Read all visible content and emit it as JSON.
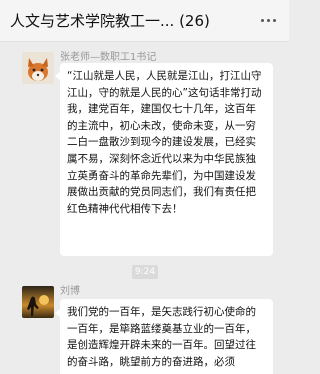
{
  "window": {
    "title": "人文与艺术学院教工一... (26)",
    "more_icon": "more-dots-icon"
  },
  "messages": [
    {
      "sender": "张老师—数职工1书记",
      "avatar": "fox-avatar",
      "text": "“江山就是人民，人民就是江山，打江山守江山，守的就是人民的心”这句话非常打动我，建党百年，建国仅七十几年，这百年的主流中，初心未改，使命未变，从一穷二白一盘散沙到现今的建设发展，已经实属不易，深刻怀念近代以来为中华民族独立英勇奋斗的革命先辈们，为中国建设发展做出贡献的党员同志们，我们有责任把红色精神代代相传下去！"
    },
    {
      "time": "9:24"
    },
    {
      "sender": "刘博",
      "avatar": "silhouette-avatar",
      "text": "我们党的一百年，是矢志践行初心使命的一百年，是筚路蓝缕奠基立业的一百年，是创造辉煌开辟未来的一百年。回望过往的奋斗路，眺望前方的奋进路，必须"
    }
  ]
}
